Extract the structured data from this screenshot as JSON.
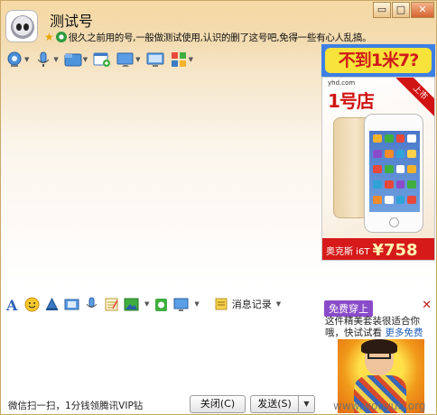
{
  "window": {
    "contact_name": "测试号",
    "signature": "很久之前用的号,一般做测试使用,认识的删了这号吧,免得一些有心人乱搞。",
    "controls": {
      "minimize": "▭",
      "maximize": "□",
      "close": "✕"
    }
  },
  "toolbar": {
    "items": [
      {
        "name": "video-call",
        "icon": "webcam-icon"
      },
      {
        "name": "voice-call",
        "icon": "microphone-icon"
      },
      {
        "name": "send-file",
        "icon": "folder-icon"
      },
      {
        "name": "app-add",
        "icon": "window-add-icon"
      },
      {
        "name": "remote-desktop",
        "icon": "screen-share-icon"
      },
      {
        "name": "screen",
        "icon": "monitor-icon"
      },
      {
        "name": "apps",
        "icon": "grid-icon"
      }
    ]
  },
  "ad_top": {
    "text": "不到1米7?"
  },
  "ad_phone": {
    "site": "yhd.com",
    "logo": "1号店",
    "ribbon": "上市",
    "model": "奥克斯 i6T",
    "price": "¥758"
  },
  "input_toolbar": {
    "items": [
      {
        "name": "font",
        "icon": "font-icon"
      },
      {
        "name": "emoji",
        "icon": "smiley-icon"
      },
      {
        "name": "shake",
        "icon": "bell-icon"
      },
      {
        "name": "screenshot-frame",
        "icon": "film-icon"
      },
      {
        "name": "voice-message",
        "icon": "voice-icon"
      },
      {
        "name": "note",
        "icon": "note-icon"
      },
      {
        "name": "image",
        "icon": "image-icon"
      },
      {
        "name": "gift",
        "icon": "gift-icon"
      },
      {
        "name": "screen-capture",
        "icon": "screen-capture-icon"
      }
    ],
    "history_label": "消息记录"
  },
  "ad_bottom": {
    "badge": "免费穿上",
    "text": "这件精美套装很适合你哦，快试试看",
    "link": "更多免费",
    "close": "✕"
  },
  "bottom_bar": {
    "promo": "微信扫一扫，1分钱领腾讯VIP钻",
    "close_label": "关闭(C)",
    "send_label": "发送(S)",
    "send_menu": "▼"
  },
  "watermark": "www.wooyun.org",
  "colors": {
    "title_gradient_top": "#f6d9a4",
    "ad_red": "#d01a1a",
    "ad_blue": "#3e7fe3",
    "ad_yellow": "#f7e33a",
    "link_blue": "#1f5fb8",
    "badge_purple": "#8a4bc9"
  }
}
